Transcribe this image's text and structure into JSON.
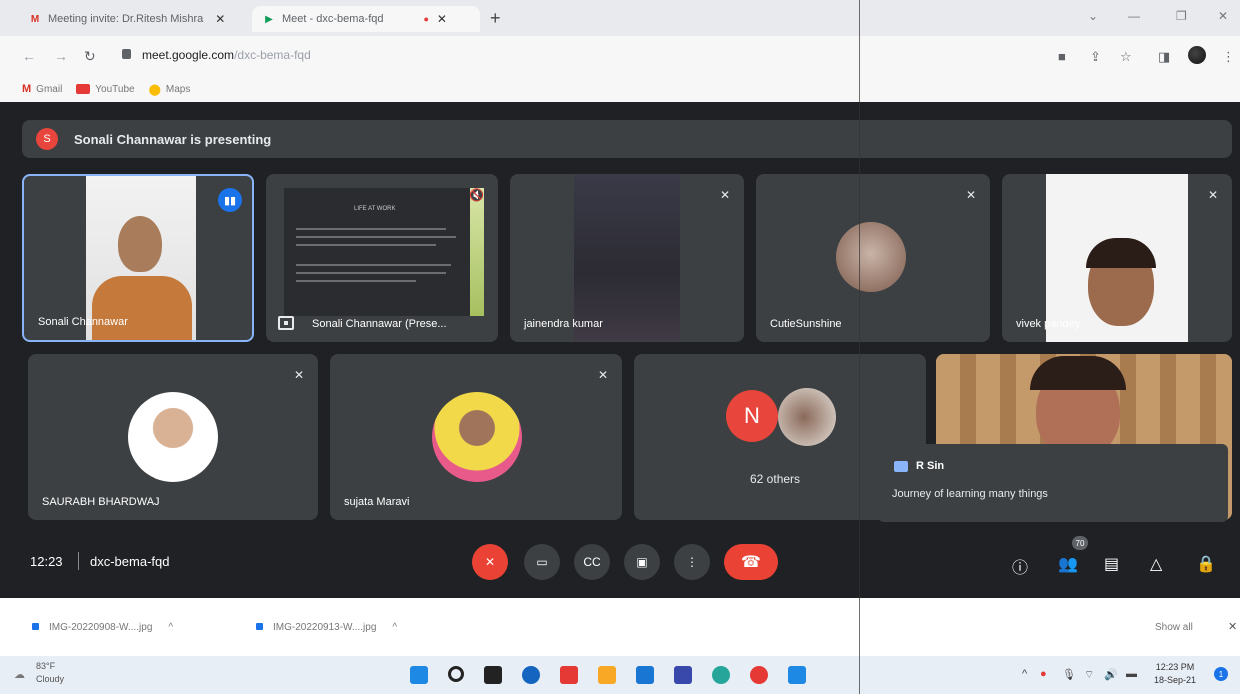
{
  "browser": {
    "tabs": [
      {
        "label": "Meeting invite: Dr.Ritesh Mishra",
        "close": "✕"
      },
      {
        "label": "Meet - dxc-bema-fqd",
        "close": "✕"
      }
    ],
    "new_tab": "+",
    "url_host": "meet.google.com",
    "url_path": "/dxc-bema-fqd",
    "bookmarks": [
      "Gmail",
      "YouTube",
      "Maps"
    ]
  },
  "meet": {
    "banner_avatar": "S",
    "banner_text": "Sonali Channawar is presenting",
    "tiles": [
      {
        "name": "Sonali Channawar"
      },
      {
        "name": "Sonali Channawar (Prese..."
      },
      {
        "name": "jainendra kumar"
      },
      {
        "name": "CutieSunshine"
      },
      {
        "name": "vivek pandey"
      },
      {
        "name": "SAURABH BHARDWAJ"
      },
      {
        "name": "sujata Maravi"
      }
    ],
    "others": {
      "initial": "N",
      "label": "62 others"
    },
    "slide_title": "LIFE AT WORK",
    "chat": {
      "sender": "R Sin",
      "message": "Journey of learning many things"
    },
    "bottom": {
      "time": "12:23",
      "code": "dxc-bema-fqd",
      "people_count": "70"
    }
  },
  "downloads": {
    "files": [
      "IMG-20220908-W....jpg",
      "IMG-20220913-W....jpg"
    ],
    "show_all": "Show all"
  },
  "taskbar": {
    "weather_temp": "83°F",
    "weather_desc": "Cloudy",
    "time": "12:23 PM",
    "date": "18-Sep-21"
  },
  "colors": {
    "meet_bg": "#202124",
    "tile_bg": "#3c4043",
    "end_call": "#ea4335",
    "accent": "#1a73e8"
  }
}
